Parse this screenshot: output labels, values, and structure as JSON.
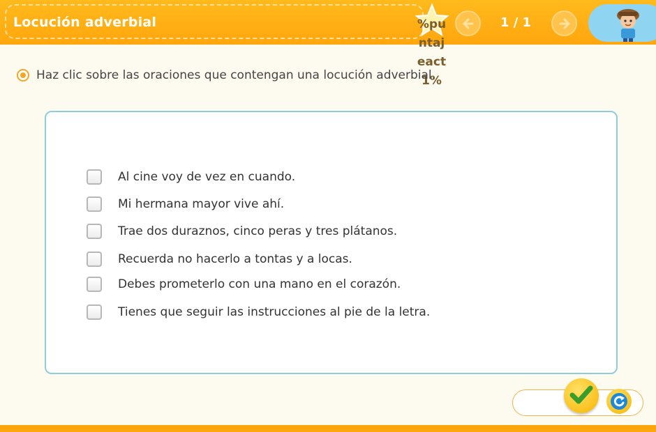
{
  "header": {
    "title": "Locución adverbial",
    "score_text": "%puntajeact1%",
    "page_indicator": "1 / 1",
    "prev_icon": "arrow-left-icon",
    "next_icon": "arrow-right-icon",
    "avatar_icon": "student-avatar-icon"
  },
  "instruction": {
    "text": "Haz clic sobre las oraciones que contengan una locución adverbial."
  },
  "options": [
    {
      "label": "Al cine voy de vez en cuando.",
      "checked": false
    },
    {
      "label": "Mi hermana mayor vive ahí.",
      "checked": false
    },
    {
      "label": "Trae dos duraznos, cinco peras y tres plátanos.",
      "checked": false
    },
    {
      "label": "Recuerda no hacerlo a tontas y a locas.",
      "checked": false
    },
    {
      "label": "Debes prometerlo con una mano en el corazón.",
      "checked": false
    },
    {
      "label": "Tienes que seguir las instrucciones al pie de la letra.",
      "checked": false
    }
  ],
  "footer": {
    "check_icon": "checkmark-icon",
    "reset_icon": "reset-icon"
  },
  "colors": {
    "header": "#ffa60d",
    "panel_border": "#8ecdd8",
    "accent": "#f5a623"
  }
}
